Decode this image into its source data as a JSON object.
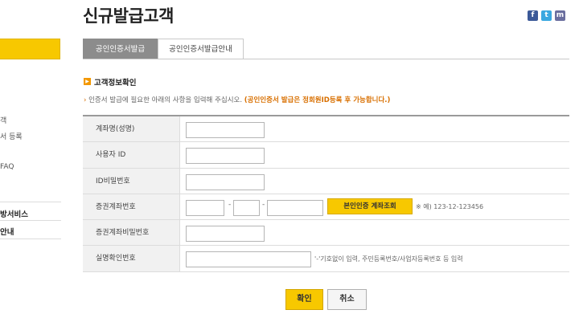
{
  "page": {
    "title": "신규발급고객"
  },
  "social": {
    "facebook": "f",
    "twitter": "t",
    "me": "m"
  },
  "sidebar": {
    "items": [
      "객",
      "서 등록",
      "FAQ",
      "방서비스",
      "안내"
    ]
  },
  "tabs": [
    {
      "label": "공인인증서발급",
      "active": true
    },
    {
      "label": "공인인증서발급안내",
      "active": false
    }
  ],
  "section": {
    "title": "고객정보확인",
    "notice_text": "인증서 발급에 필요한 아래의 사항을 입력해 주십시오.",
    "notice_highlight": "(공인인증서 발급은 정회원ID등록 후 가능합니다.)"
  },
  "form": {
    "rows": [
      {
        "label": "계좌명(성명)"
      },
      {
        "label": "사용자 ID"
      },
      {
        "label": "ID비밀번호"
      },
      {
        "label": "증권계좌번호"
      },
      {
        "label": "증권계좌비밀번호"
      },
      {
        "label": "실명확인번호"
      }
    ],
    "account_dash": "-",
    "lookup_button": "본인인증 계좌조회",
    "account_example": "※ 예) 123-12-123456",
    "id_number_hint": "'-'기호없이 입력, 주민등록번호/사업자등록번호 등 입력"
  },
  "buttons": {
    "confirm": "확인",
    "cancel": "취소"
  },
  "colors": {
    "accent": "#f7c800",
    "tab_active": "#8c8c8c",
    "highlight": "#d86f00"
  }
}
